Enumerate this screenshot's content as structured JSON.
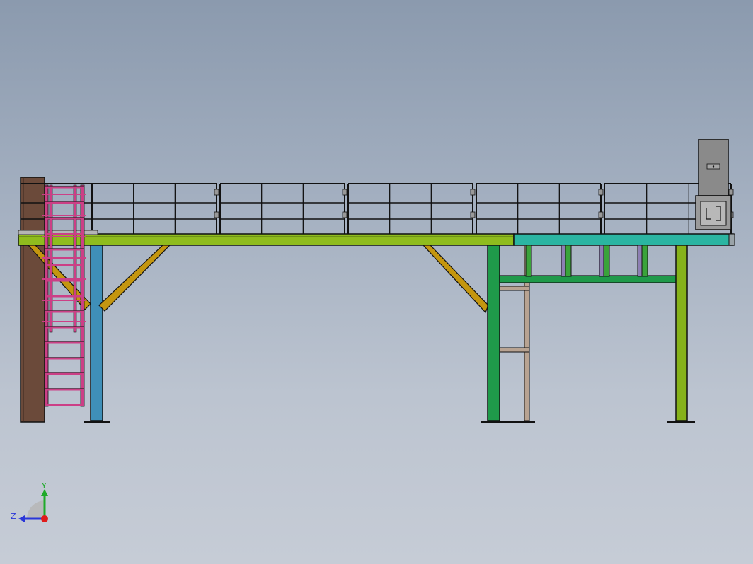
{
  "viewport": {
    "background_top": "#8b9aae",
    "background_bottom": "#c6ccd6"
  },
  "model": {
    "colors": {
      "outline": "#111111",
      "platform_deck_left": "#8fbc1e",
      "platform_deck_right": "#2bb5a2",
      "ladder": "#cc3f86",
      "column_left": "#3f8fb8",
      "column_wood": "#6b4a3a",
      "column_green": "#1f9a4a",
      "column_right": "#86b21a",
      "brace": "#c4960f",
      "frame_tan": "#b8a392",
      "purple_rod": "#8d7fb3",
      "cabinet": "#8a8a8a"
    }
  },
  "triad": {
    "y_label": "Y",
    "z_label": "Z",
    "y_color": "#1faa2a",
    "z_color": "#2a36d8",
    "x_color": "#e01b1b"
  }
}
